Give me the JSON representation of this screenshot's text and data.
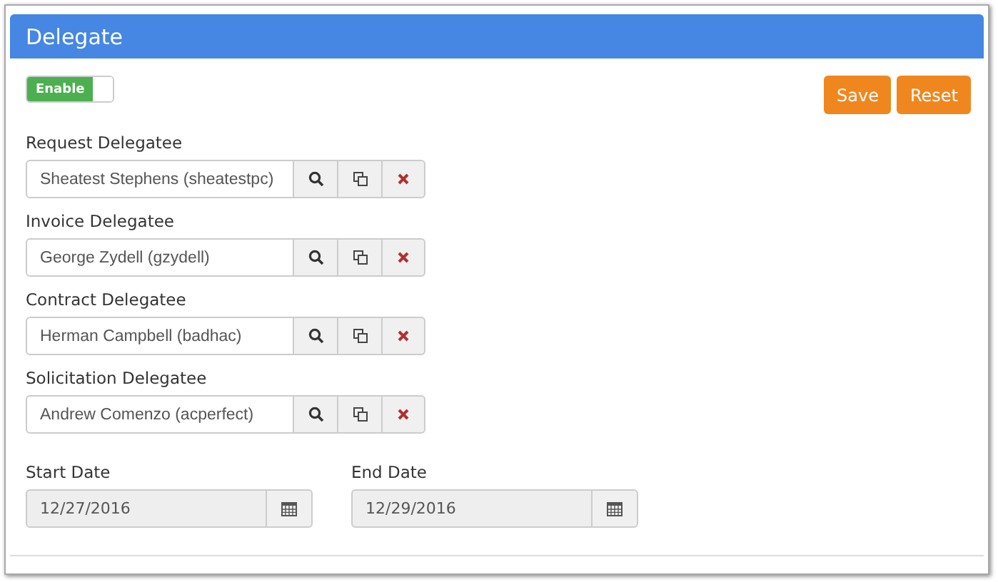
{
  "panel": {
    "title": "Delegate"
  },
  "toggle": {
    "label": "Enable",
    "on": true
  },
  "buttons": [
    "Save",
    "Reset"
  ],
  "delegatees": [
    {
      "label": "Request Delegatee",
      "value": "Sheatest Stephens (sheatestpc)"
    },
    {
      "label": "Invoice Delegatee",
      "value": "George Zydell (gzydell)"
    },
    {
      "label": "Contract Delegatee",
      "value": "Herman Campbell (badhac)"
    },
    {
      "label": "Solicitation Delegatee",
      "value": "Andrew Comenzo (acperfect)"
    }
  ],
  "dates": [
    {
      "label": "Start Date",
      "value": "12/27/2016",
      "disabled": true
    },
    {
      "label": "End Date",
      "value": "12/29/2016",
      "disabled": true
    }
  ]
}
